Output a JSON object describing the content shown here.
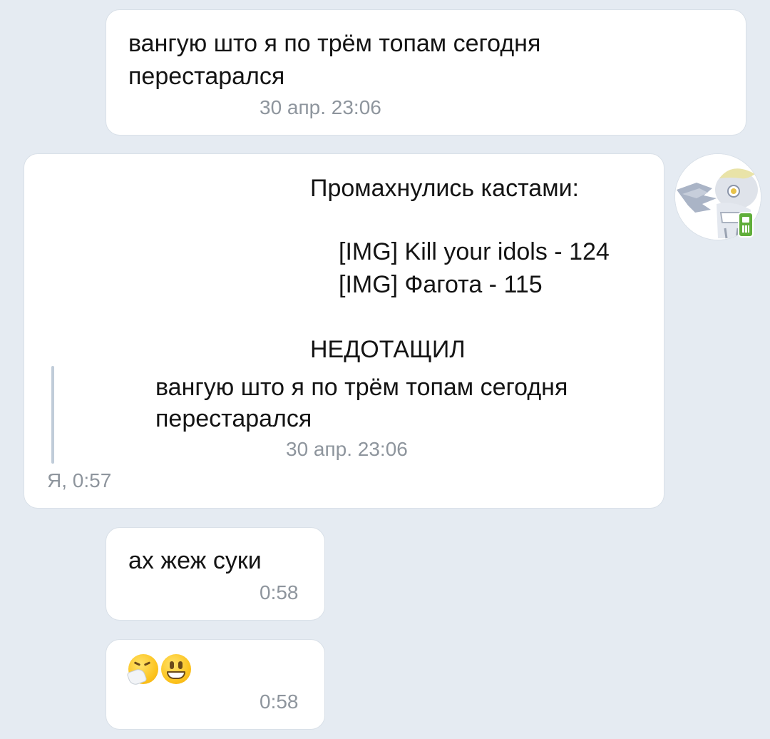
{
  "messages": [
    {
      "text_lines": [
        "вангую што я по трём топам сегодня",
        "перестарался"
      ],
      "time": "30 апр. 23:06"
    },
    {
      "lines": [
        "Промахнулись кастами:",
        "[IMG] Kill your idols - 124",
        "[IMG] Фагота - 115",
        "НЕДОТАЩИЛ"
      ],
      "quote": {
        "lines": [
          "вангую што я по трём топам сегодня",
          "перестарался"
        ],
        "time": "30 апр. 23:06"
      },
      "sender_time": "Я, 0:57",
      "avatar": "pony-avatar-icon",
      "badge": "mobile-phone-icon"
    },
    {
      "text": "ах жеж суки",
      "time": "0:58"
    },
    {
      "emojis": [
        "sneezing-face-icon",
        "grinning-face-icon"
      ],
      "time": "0:58"
    }
  ],
  "colors": {
    "background": "#e5ebf2",
    "bubble": "#ffffff",
    "time_text": "#8e959d",
    "quote_bar": "#c0ccd9",
    "badge": "#5fae3a"
  }
}
